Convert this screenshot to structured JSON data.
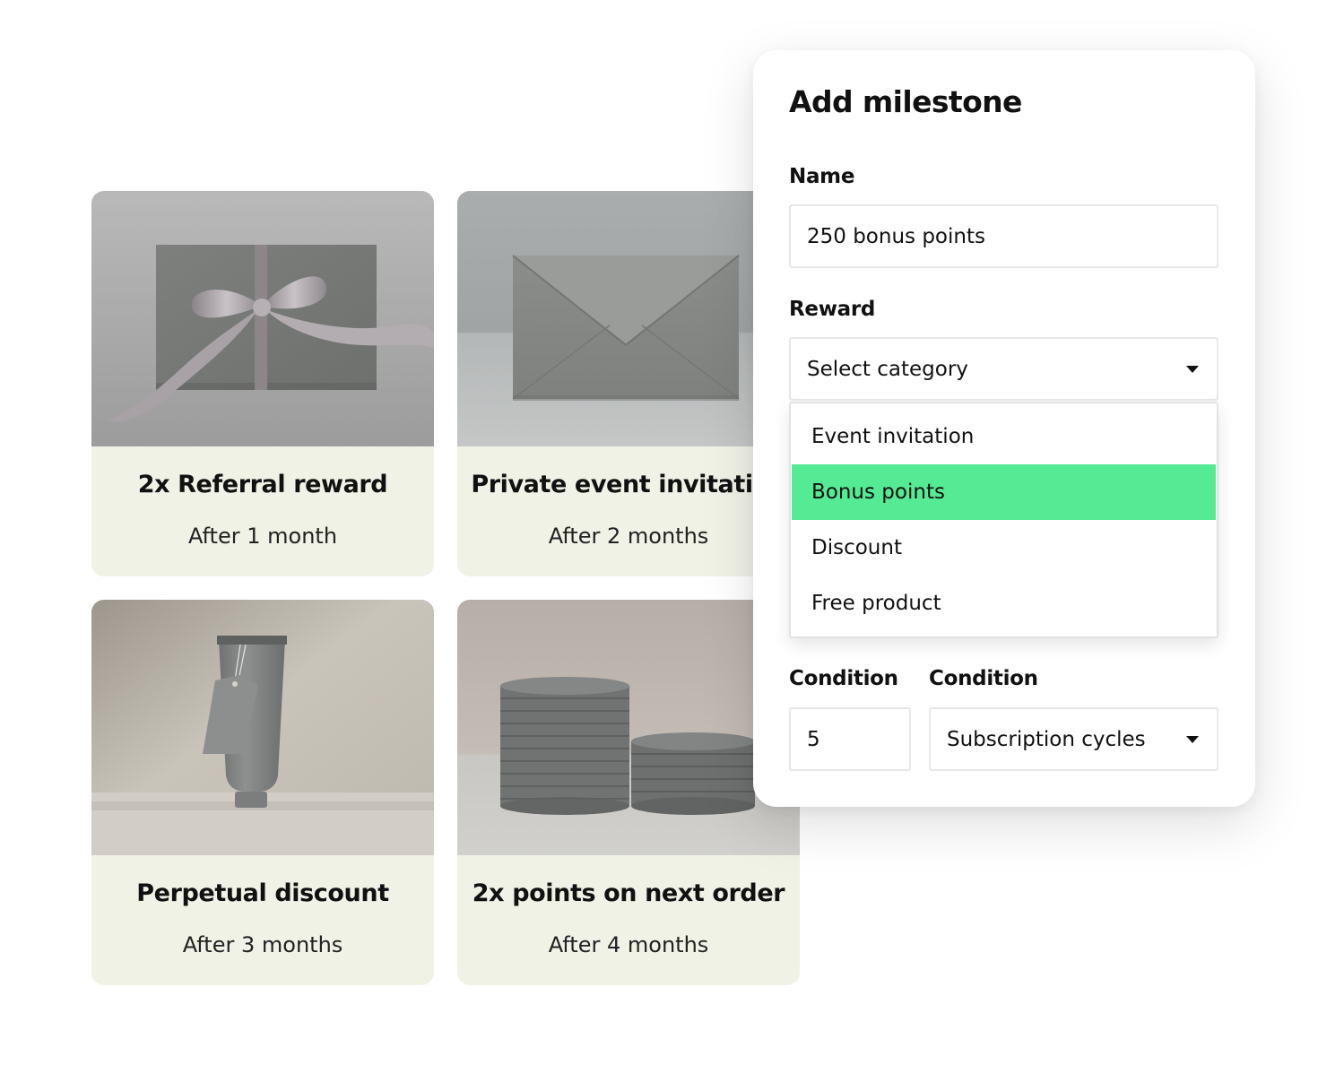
{
  "cards": [
    {
      "title": "2x Referral reward",
      "subtitle": "After 1 month",
      "image": "gift-envelope-with-ribbon"
    },
    {
      "title": "Private event invitation",
      "subtitle": "After 2 months",
      "image": "envelope"
    },
    {
      "title": "Perpetual discount",
      "subtitle": "After 3 months",
      "image": "tube-with-tag"
    },
    {
      "title": "2x points on next order",
      "subtitle": "After 4 months",
      "image": "coin-stacks"
    }
  ],
  "modal": {
    "title": "Add milestone",
    "name": {
      "label": "Name",
      "value": "250 bonus points"
    },
    "reward": {
      "label": "Reward",
      "placeholder": "Select category",
      "options": [
        "Event invitation",
        "Bonus points",
        "Discount",
        "Free product"
      ],
      "highlighted": "Bonus points"
    },
    "condition_value": {
      "label": "Condition",
      "value": "5"
    },
    "condition_unit": {
      "label": "Condition",
      "value": "Subscription cycles"
    }
  },
  "colors": {
    "card_bg": "#f0f2e6",
    "highlight": "#54eb94",
    "border": "#e7e7e7"
  }
}
